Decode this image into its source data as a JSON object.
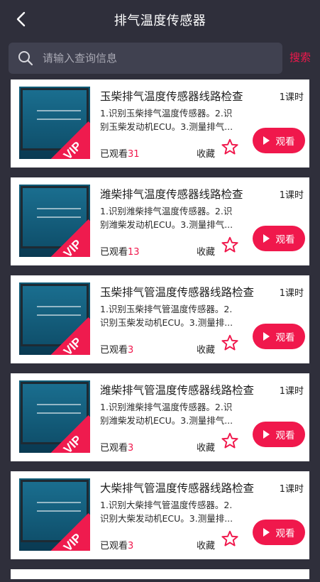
{
  "header": {
    "title": "排气温度传感器"
  },
  "search": {
    "placeholder": "请输入查询信息",
    "button": "搜索"
  },
  "common": {
    "fav_label": "收藏",
    "watch_label": "观看",
    "watched_prefix": "已观看",
    "vip_badge": "VIP"
  },
  "colors": {
    "accent": "#f0184c",
    "background": "#2f2f3b",
    "search_bg": "#404150"
  },
  "courses": [
    {
      "title": "玉柴排气温度传感器线路检查",
      "lessons": "1课时",
      "desc": "1.识别玉柴排气温度传感器。2.识别玉柴发动机ECU。3.测量排气...",
      "watched": "31"
    },
    {
      "title": "潍柴排气温度传感器线路检查",
      "lessons": "1课时",
      "desc": "1.识别潍柴排气温度传感器。2.识别潍柴发动机ECU。3.测量排气...",
      "watched": "13"
    },
    {
      "title": "玉柴排气管温度传感器线路检查",
      "lessons": "1课时",
      "desc": "1.识别玉柴排气管温度传感器。2.识别玉柴发动机ECU。3.测量排...",
      "watched": "3"
    },
    {
      "title": "潍柴排气管温度传感器线路检查",
      "lessons": "1课时",
      "desc": "1.识别潍柴排气温度传感器。2.识别潍柴发动机ECU。3.测量排气...",
      "watched": "3"
    },
    {
      "title": "大柴排气管温度传感器线路检查",
      "lessons": "1课时",
      "desc": "1.识别大柴排气管温度传感器。2.识别大柴发动机ECU。3.测量排...",
      "watched": "3"
    }
  ]
}
